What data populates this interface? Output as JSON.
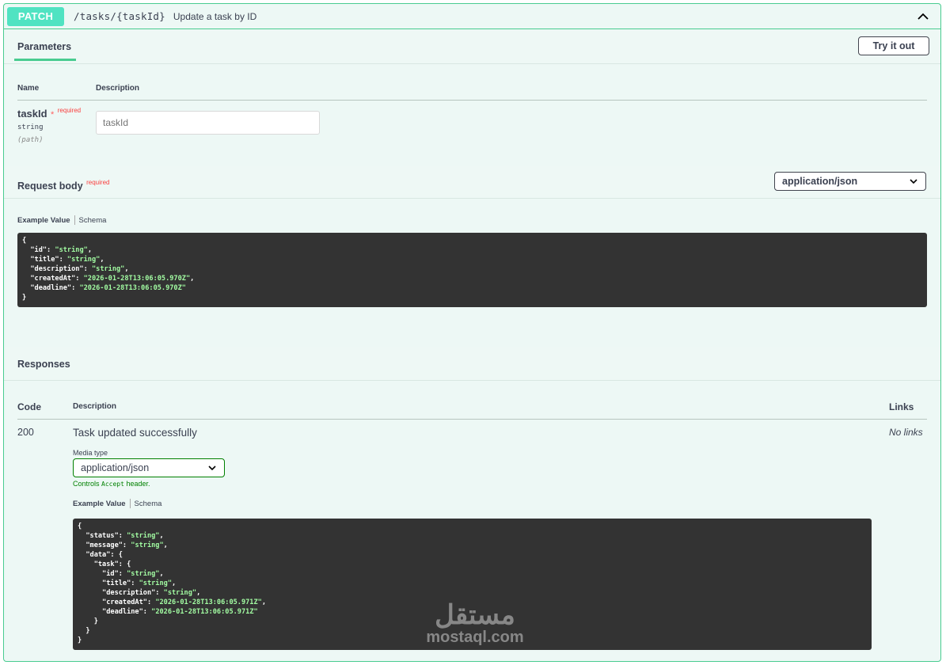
{
  "summary": {
    "method": "PATCH",
    "path": "/tasks/{taskId}",
    "description": "Update a task by ID"
  },
  "parameters": {
    "tab_label": "Parameters",
    "try_button": "Try it out",
    "col_name": "Name",
    "col_description": "Description",
    "param": {
      "name": "taskId",
      "required_star": "*",
      "required_label": "required",
      "type": "string",
      "location": "(path)",
      "placeholder": "taskId"
    }
  },
  "request_body": {
    "title": "Request body",
    "required_label": "required",
    "content_type": "application/json",
    "example_tab": "Example Value",
    "schema_tab": "Schema",
    "example_lines": [
      {
        "indent": "",
        "key": "",
        "value": "",
        "raw": "{"
      },
      {
        "indent": "  ",
        "key": "\"id\"",
        "value": "\"string\"",
        "raw": ""
      },
      {
        "indent": "  ",
        "key": "\"title\"",
        "value": "\"string\"",
        "raw": ""
      },
      {
        "indent": "  ",
        "key": "\"description\"",
        "value": "\"string\"",
        "raw": ""
      },
      {
        "indent": "  ",
        "key": "\"createdAt\"",
        "value": "\"2026-01-28T13:06:05.970Z\"",
        "raw": ""
      },
      {
        "indent": "  ",
        "key": "\"deadline\"",
        "value": "\"2026-01-28T13:06:05.970Z\"",
        "raw": ""
      },
      {
        "indent": "",
        "key": "",
        "value": "",
        "raw": "}"
      }
    ]
  },
  "responses": {
    "title": "Responses",
    "col_code": "Code",
    "col_description": "Description",
    "col_links": "Links",
    "row": {
      "code": "200",
      "description": "Task updated successfully",
      "links": "No links",
      "media_type_label": "Media type",
      "media_type": "application/json",
      "controls_prefix": "Controls",
      "controls_code": "Accept",
      "controls_suffix": "header.",
      "example_tab": "Example Value",
      "schema_tab": "Schema"
    },
    "example_lines": [
      {
        "indent": "",
        "key": "",
        "value": "",
        "raw": "{"
      },
      {
        "indent": "  ",
        "key": "\"status\"",
        "value": "\"string\"",
        "raw": ""
      },
      {
        "indent": "  ",
        "key": "\"message\"",
        "value": "\"string\"",
        "raw": ""
      },
      {
        "indent": "  ",
        "key": "\"data\"",
        "value": "",
        "raw": "{"
      },
      {
        "indent": "    ",
        "key": "\"task\"",
        "value": "",
        "raw": "{"
      },
      {
        "indent": "      ",
        "key": "\"id\"",
        "value": "\"string\"",
        "raw": ""
      },
      {
        "indent": "      ",
        "key": "\"title\"",
        "value": "\"string\"",
        "raw": ""
      },
      {
        "indent": "      ",
        "key": "\"description\"",
        "value": "\"string\"",
        "raw": ""
      },
      {
        "indent": "      ",
        "key": "\"createdAt\"",
        "value": "\"2026-01-28T13:06:05.971Z\"",
        "raw": ""
      },
      {
        "indent": "      ",
        "key": "\"deadline\"",
        "value": "\"2026-01-28T13:06:05.971Z\"",
        "raw": ""
      },
      {
        "indent": "    ",
        "key": "",
        "value": "",
        "raw": "}"
      },
      {
        "indent": "  ",
        "key": "",
        "value": "",
        "raw": "}"
      },
      {
        "indent": "",
        "key": "",
        "value": "",
        "raw": "}"
      }
    ]
  },
  "watermark": {
    "arabic": "مستقل",
    "latin": "mostaql.com"
  },
  "colors": {
    "accent": "#49cc90",
    "method_badge": "#50e3c2",
    "code_bg": "#333333",
    "code_string": "#a2fca2",
    "required": "#f93e3e"
  }
}
